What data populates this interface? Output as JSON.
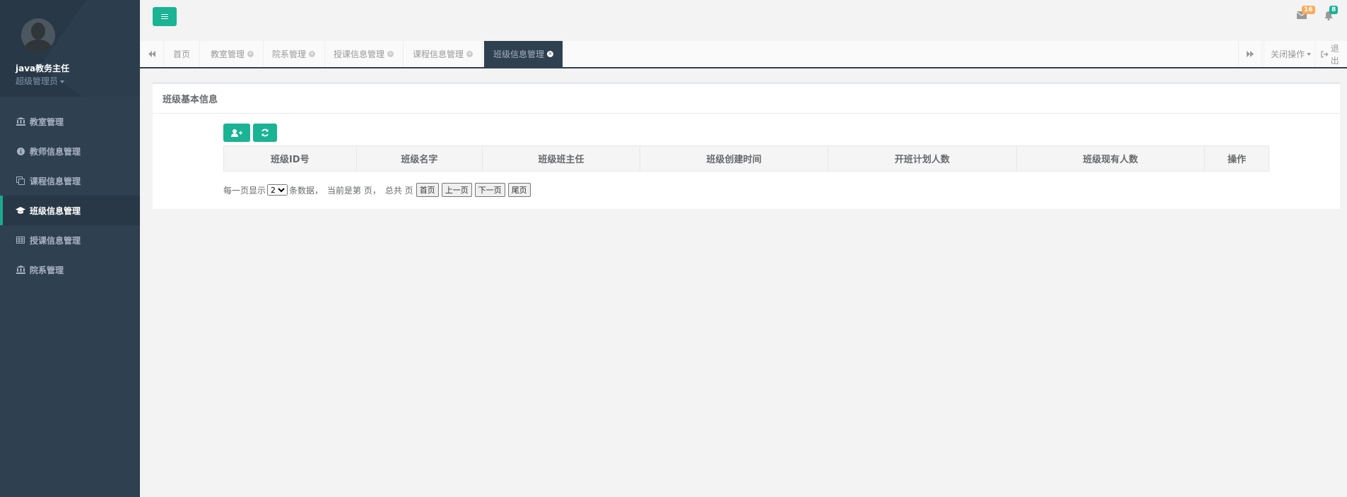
{
  "user": {
    "name": "java教务主任",
    "role": "超级管理员"
  },
  "nav": [
    {
      "label": "教室管理",
      "icon": "bank-icon",
      "active": false
    },
    {
      "label": "教师信息管理",
      "icon": "info-circle-icon",
      "active": false
    },
    {
      "label": "课程信息管理",
      "icon": "copy-icon",
      "active": false
    },
    {
      "label": "班级信息管理",
      "icon": "graduation-cap-icon",
      "active": true
    },
    {
      "label": "授课信息管理",
      "icon": "table-icon",
      "active": false
    },
    {
      "label": "院系管理",
      "icon": "bank-icon",
      "active": false
    }
  ],
  "header": {
    "mail_count": "16",
    "bell_count": "8"
  },
  "tabs": [
    {
      "label": "首页",
      "closable": false,
      "active": false
    },
    {
      "label": "教室管理",
      "closable": true,
      "active": false
    },
    {
      "label": "院系管理",
      "closable": true,
      "active": false
    },
    {
      "label": "授课信息管理",
      "closable": true,
      "active": false
    },
    {
      "label": "课程信息管理",
      "closable": true,
      "active": false
    },
    {
      "label": "班级信息管理",
      "closable": true,
      "active": true
    }
  ],
  "tab_actions": {
    "close_ops": "关闭操作",
    "logout": "退出"
  },
  "panel": {
    "title": "班级基本信息",
    "columns": [
      "班级ID号",
      "班级名字",
      "班级班主任",
      "班级创建时间",
      "开班计划人数",
      "班级现有人数",
      "操作"
    ]
  },
  "pager": {
    "prefix": "每一页显示",
    "page_size": "2",
    "suffix": "条数据，",
    "current": "当前是第 页，",
    "total": "总共 页",
    "first": "首页",
    "prev": "上一页",
    "next": "下一页",
    "last": "尾页"
  },
  "colors": {
    "accent": "#1ab394",
    "sidebar": "#2f4050",
    "mail_badge": "#f8ac59",
    "bell_badge": "#1ab394"
  }
}
